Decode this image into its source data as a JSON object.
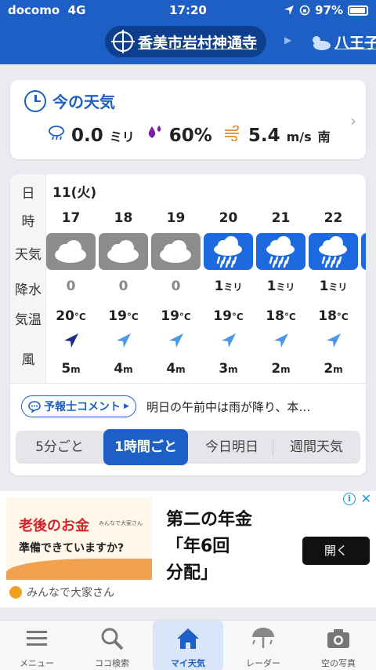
{
  "status": {
    "carrier": "docomo",
    "network": "4G",
    "time": "17:20",
    "battery": "97%"
  },
  "header": {
    "location": "香美市岩村神通寺",
    "next_location": "八王子"
  },
  "now": {
    "title": "今の天気",
    "rain_value": "0.0",
    "rain_unit": "ミリ",
    "humidity": "60%",
    "wind_value": "5.4",
    "wind_unit": "m/s",
    "wind_dir": "南"
  },
  "forecast": {
    "row_labels": {
      "day": "日",
      "hour": "時",
      "weather": "天気",
      "precip": "降水",
      "temp": "気温",
      "wind": "風"
    },
    "date": "11(火)",
    "hours": [
      {
        "hour": "17",
        "weather": "cloudy-icon",
        "precip": "0",
        "precip_unit": "",
        "temp": "20",
        "wind": "5",
        "wind_strong": true
      },
      {
        "hour": "18",
        "weather": "cloudy-icon",
        "precip": "0",
        "precip_unit": "",
        "temp": "19",
        "wind": "4",
        "wind_strong": false
      },
      {
        "hour": "19",
        "weather": "cloudy-icon",
        "precip": "0",
        "precip_unit": "",
        "temp": "19",
        "wind": "4",
        "wind_strong": false
      },
      {
        "hour": "20",
        "weather": "rain-icon",
        "precip": "1",
        "precip_unit": "ミリ",
        "temp": "19",
        "wind": "3",
        "wind_strong": false
      },
      {
        "hour": "21",
        "weather": "rain-icon",
        "precip": "1",
        "precip_unit": "ミリ",
        "temp": "18",
        "wind": "2",
        "wind_strong": false
      },
      {
        "hour": "22",
        "weather": "rain-icon",
        "precip": "1",
        "precip_unit": "ミリ",
        "temp": "18",
        "wind": "2",
        "wind_strong": false
      }
    ],
    "temp_unit": "°C",
    "wind_unit": "m",
    "comment_label": "予報士コメント",
    "comment_text": "明日の午前中は雨が降り、本…",
    "tabs": [
      "5分ごと",
      "1時間ごと",
      "今日明日",
      "週間天気"
    ],
    "active_tab": 1
  },
  "ad": {
    "left_title": "老後のお金",
    "left_brand_small": "みんなで大家さん",
    "left_sub": "準備できていますか?",
    "headline_1": "第二の年金",
    "headline_2": "「年6回",
    "headline_3": "分配」",
    "button": "開く",
    "brand": "みんなで大家さん"
  },
  "nav": [
    {
      "label": "メニュー",
      "icon": "menu-icon"
    },
    {
      "label": "ココ検索",
      "icon": "search-icon"
    },
    {
      "label": "マイ天気",
      "icon": "home-icon"
    },
    {
      "label": "レーダー",
      "icon": "radar-icon"
    },
    {
      "label": "空の写真",
      "icon": "camera-icon"
    }
  ],
  "colors": {
    "brand_blue": "#1d5fc4",
    "rain_tile": "#1d6ae0",
    "cloud_tile": "#8c8c8c",
    "ad_accent": "#d2232a"
  }
}
